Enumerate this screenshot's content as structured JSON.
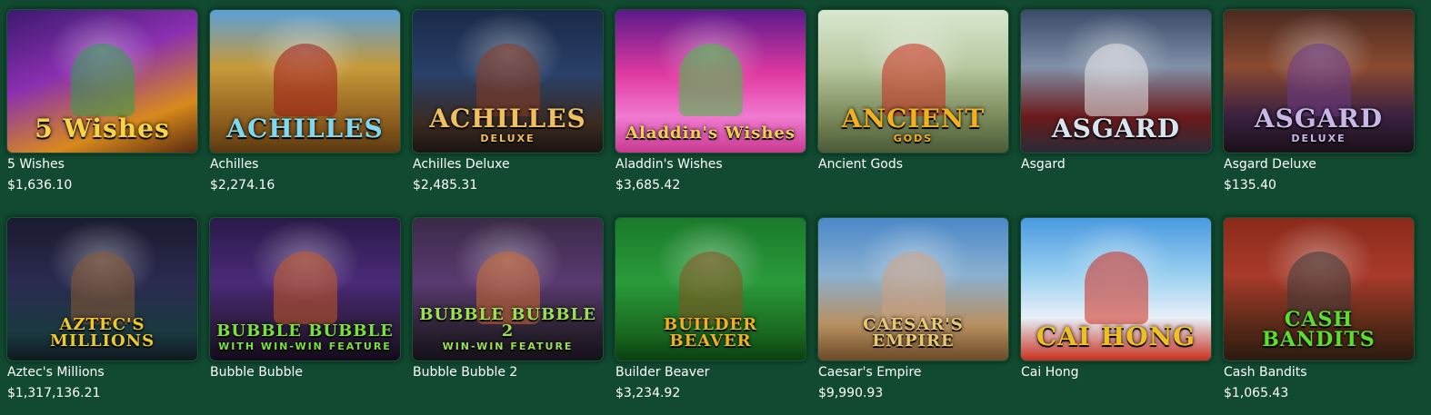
{
  "games": [
    {
      "title": "5 Wishes",
      "jackpot": "$1,636.10",
      "logo": "5 Wishes",
      "logo_sub": "",
      "bg": "linear-gradient(160deg,#3b1a6e 0%,#8a2fb0 40%,#d88a1c 75%,#5a2a10 100%)",
      "logo_color": "#f5d447",
      "figure": "#2f9f4a"
    },
    {
      "title": "Achilles",
      "jackpot": "$2,274.16",
      "logo": "ACHILLES",
      "logo_sub": "",
      "bg": "linear-gradient(180deg,#5aa0d8 0%,#c79a3a 40%,#8a5a1c 80%,#5a3a10 100%)",
      "logo_color": "#7fd8f0",
      "figure": "#a01818"
    },
    {
      "title": "Achilles Deluxe",
      "jackpot": "$2,485.31",
      "logo": "ACHILLES",
      "logo_sub": "DELUXE",
      "bg": "linear-gradient(180deg,#1a2a48 0%,#2a4068 45%,#3a2a20 80%,#1a1410 100%)",
      "logo_color": "#f0c060",
      "figure": "#8a3a20"
    },
    {
      "title": "Aladdin's Wishes",
      "jackpot": "$3,685.42",
      "logo": "Aladdin's Wishes",
      "logo_sub": "",
      "bg": "linear-gradient(180deg,#5a1a8a 0%,#e03aa0 45%,#f07ad0 75%,#c83a90 100%)",
      "logo_color": "#f0d050",
      "figure": "#40c040"
    },
    {
      "title": "Ancient Gods",
      "jackpot": "",
      "logo": "ANCIENT",
      "logo_sub": "GODS",
      "bg": "linear-gradient(180deg,#d8e8d0 0%,#b8c8a0 40%,#7a8a5a 75%,#4a5a38 100%)",
      "logo_color": "#f0b020",
      "figure": "#c82a1a"
    },
    {
      "title": "Asgard",
      "jackpot": "",
      "logo": "ASGARD",
      "logo_sub": "",
      "bg": "linear-gradient(180deg,#3a4a68 0%,#8090a8 40%,#6a1a1a 75%,#2a2a38 100%)",
      "logo_color": "#d8e4f0",
      "figure": "#e8e8e8"
    },
    {
      "title": "Asgard Deluxe",
      "jackpot": "$135.40",
      "logo": "ASGARD",
      "logo_sub": "DELUXE",
      "bg": "linear-gradient(180deg,#4a2a20 0%,#8a4a30 40%,#3a2040 75%,#1a1018 100%)",
      "logo_color": "#c8b8e8",
      "figure": "#6a3a8a"
    },
    {
      "title": "Aztec's Millions",
      "jackpot": "$1,317,136.21",
      "logo": "AZTEC'S MILLIONS",
      "logo_sub": "",
      "bg": "linear-gradient(180deg,#1a1a30 0%,#2a2a50 45%,#1a3a40 80%,#101820 100%)",
      "logo_color": "#f0c828",
      "figure": "#8a5a30"
    },
    {
      "title": "Bubble Bubble",
      "jackpot": "",
      "logo": "BUBBLE BUBBLE",
      "logo_sub": "WITH WIN-WIN FEATURE",
      "bg": "linear-gradient(180deg,#2a1a48 0%,#4a2a78 45%,#2a1a38 80%,#140a1c 100%)",
      "logo_color": "#7ae03a",
      "figure": "#c85a20"
    },
    {
      "title": "Bubble Bubble 2",
      "jackpot": "",
      "logo": "BUBBLE BUBBLE 2",
      "logo_sub": "WIN-WIN FEATURE",
      "bg": "linear-gradient(180deg,#3a2a48 0%,#5a3a70 45%,#2a2030 80%,#141018 100%)",
      "logo_color": "#9ae050",
      "figure": "#d06a30"
    },
    {
      "title": "Builder Beaver",
      "jackpot": "$3,234.92",
      "logo": "BUILDER BEAVER",
      "logo_sub": "",
      "bg": "linear-gradient(180deg,#1a7a2a 0%,#2a9a3a 45%,#1a6a20 80%,#0a4010 100%)",
      "logo_color": "#f0b020",
      "figure": "#8a5020"
    },
    {
      "title": "Caesar's Empire",
      "jackpot": "$9,990.93",
      "logo": "CAESAR'S EMPIRE",
      "logo_sub": "",
      "bg": "linear-gradient(180deg,#4a88c8 0%,#8ab0d0 40%,#b89060 75%,#6a4a28 100%)",
      "logo_color": "#e8c870",
      "figure": "#d0a080"
    },
    {
      "title": "Cai Hong",
      "jackpot": "",
      "logo": "CAI HONG",
      "logo_sub": "",
      "bg": "linear-gradient(180deg,#4a9ae0 0%,#9ad0f0 40%,#e8f0f8 70%,#c83020 100%)",
      "logo_color": "#f0c020",
      "figure": "#d02a1a"
    },
    {
      "title": "Cash Bandits",
      "jackpot": "$1,065.43",
      "logo": "CASH BANDITS",
      "logo_sub": "",
      "bg": "linear-gradient(180deg,#8a2a1a 0%,#a83a2a 40%,#5a2a18 75%,#2a1a10 100%)",
      "logo_color": "#5ae02a",
      "figure": "#3a3a3a"
    }
  ]
}
